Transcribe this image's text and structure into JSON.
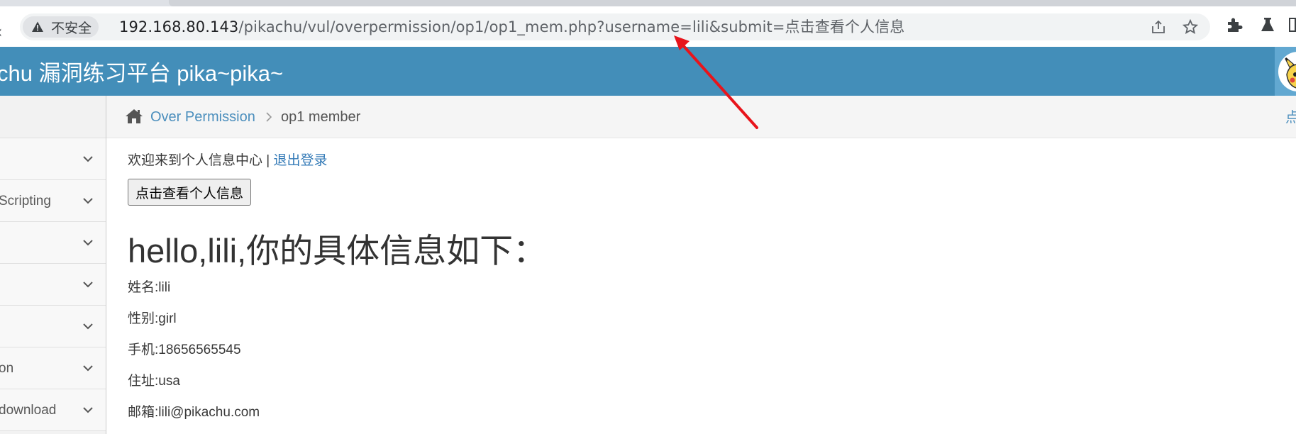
{
  "browser": {
    "security_label": "不安全",
    "url_host": "192.168.80.143",
    "url_path": "/pikachu/vul/overpermission/op1/op1_mem.php?username=lili&submit=点击查看个人信息",
    "icons": [
      "warning-icon",
      "share-icon",
      "star-icon",
      "extensions-icon",
      "labs-flask-icon"
    ]
  },
  "app": {
    "title": "chu 漏洞练习平台 pika~pika~",
    "avatar_icon": "pikachu-avatar"
  },
  "sidebar": {
    "items": [
      {
        "label": ""
      },
      {
        "label": "Scripting"
      },
      {
        "label": ""
      },
      {
        "label": ""
      },
      {
        "label": ""
      },
      {
        "label": "on"
      },
      {
        "label": "download"
      }
    ]
  },
  "breadcrumb": {
    "home_icon": "home-icon",
    "section_label": "Over Permission",
    "current_label": "op1 member",
    "right_fragment": "点"
  },
  "main": {
    "welcome_text": "欢迎来到个人信息中心 | ",
    "logout_label": "退出登录",
    "view_button_label": "点击查看个人信息",
    "greeting": "hello,lili,你的具体信息如下：",
    "info": {
      "name": "姓名:lili",
      "gender": "性别:girl",
      "phone": "手机:18656565545",
      "address": "住址:usa",
      "email": "邮箱:lili@pikachu.com"
    }
  },
  "colors": {
    "header_bg": "#438eb9",
    "link": "#4c8fbd",
    "annotation_arrow": "#e8141b"
  }
}
